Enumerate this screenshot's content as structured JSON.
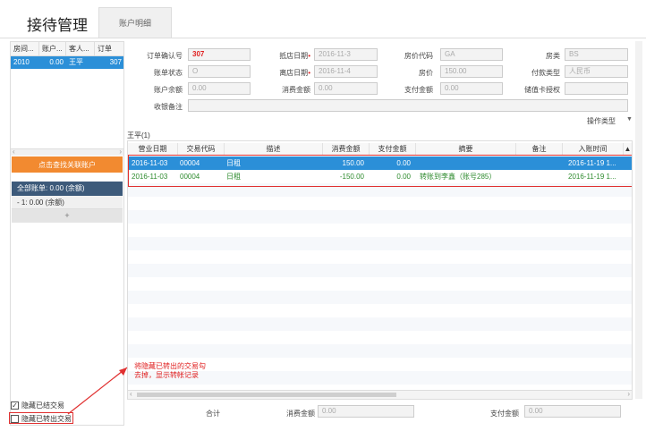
{
  "header": {
    "title": "接待管理",
    "tab_label": "账户明细"
  },
  "left_panel": {
    "columns": [
      "房间...",
      "账户...",
      "客人...",
      "订单"
    ],
    "rows": [
      {
        "room": "2010",
        "amount": "0.00",
        "guest": "王平",
        "order": "307"
      }
    ],
    "orange_button": "点击查找关联账户",
    "summary_header": "全部账单: 0.00 (余额)",
    "summary_row": "- 1: 0.00 (余额)",
    "add_symbol": "+",
    "checkbox1": {
      "label": "隐藏已结交易",
      "checked": true
    },
    "checkbox2": {
      "label": "隐藏已转出交易",
      "checked": false
    }
  },
  "form": {
    "order_id_label": "订单确认号",
    "order_id_value": "307",
    "arrival_label": "抵店日期",
    "arrival_value": "2016-11-3",
    "room_code_label": "房价代码",
    "room_code_value": "GA",
    "room_type_label": "房类",
    "room_type_value": "BS",
    "account_status_label": "账单状态",
    "account_status_value": "O",
    "departure_label": "离店日期",
    "departure_value": "2016-11-4",
    "price_label": "房价",
    "price_value": "150.00",
    "payment_type_label": "付款类型",
    "payment_type_value": "人民币",
    "balance_label": "账户余额",
    "balance_value": "0.00",
    "consume_label": "消费金额",
    "consume_value": "0.00",
    "paid_label": "支付金额",
    "paid_value": "0.00",
    "card_auth_label": "储值卡授权",
    "card_auth_value": "",
    "remark_label": "收银备注",
    "remark_value": ""
  },
  "grid": {
    "operation_type": "操作类型",
    "caption": "王平(1)",
    "columns": [
      "营业日期",
      "交易代码",
      "描述",
      "消费金额",
      "支付金额",
      "摘要",
      "备注",
      "入账时间"
    ],
    "rows": [
      {
        "date": "2016-11-03",
        "code": "00004",
        "desc": "日租",
        "consume": "150.00",
        "paid": "0.00",
        "summary": "",
        "remark": "",
        "time": "2016-11-19 1..."
      },
      {
        "date": "2016-11-03",
        "code": "00004",
        "desc": "日租",
        "consume": "-150.00",
        "paid": "0.00",
        "summary": "转账到李鑫（账号285）",
        "remark": "",
        "time": "2016-11-19 1..."
      }
    ]
  },
  "annotation": "将隐藏已转出的交易勾去掉，显示转帐记录",
  "footer": {
    "total_label": "合计",
    "consume_label": "消费金额",
    "consume_value": "0.00",
    "paid_label": "支付金额",
    "paid_value": "0.00"
  },
  "colors": {
    "selected_row": "#2b8fd8",
    "orange_button": "#f28a30",
    "summary_header": "#3d5a7a",
    "annotation_red": "#e02020",
    "green_text": "#2d8a2d"
  }
}
